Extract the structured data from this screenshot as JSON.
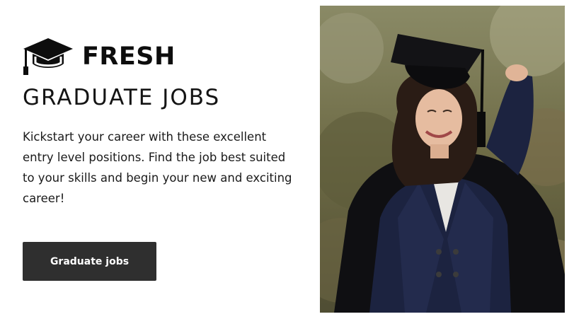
{
  "brand": {
    "icon": "graduation-cap-icon",
    "word": "FRESH"
  },
  "headline": "GRADUATE JOBS",
  "intro": "Kickstart your career with these excellent entry level positions. Find the job best suited to your skills and begin your new and exciting career!",
  "cta": {
    "label": "Graduate jobs"
  },
  "photo": {
    "subject": "graduate-photo"
  },
  "colors": {
    "text": "#111111",
    "button_bg": "#2f2f2f",
    "button_text": "#ffffff",
    "gown": "#1c2340"
  }
}
